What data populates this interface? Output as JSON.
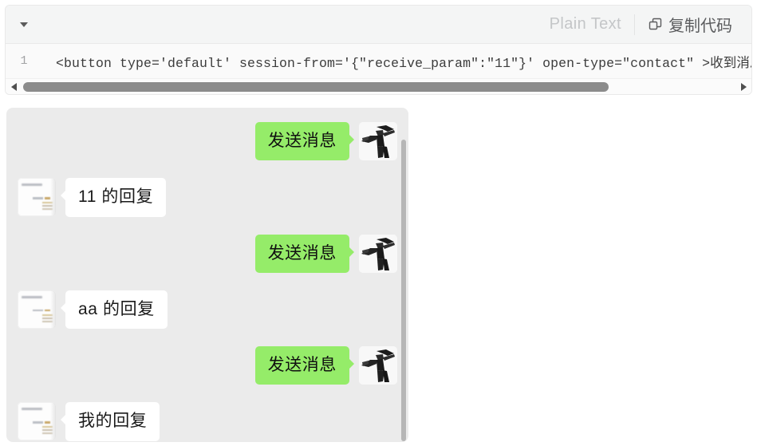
{
  "code_block": {
    "collapse_icon": "chevron-down-icon",
    "language_label": "Plain Text",
    "copy_label": "复制代码",
    "copy_icon": "copy-icon",
    "line_number": "1",
    "code_text": "<button type='default' session-from='{\"receive_param\":\"11\"}' open-type=\"contact\" >收到消息对",
    "hscroll": {
      "left_arrow": "triangle-left-icon",
      "right_arrow": "triangle-right-icon",
      "thumb_width_pct": "82"
    }
  },
  "chat": {
    "background_color": "#ebebeb",
    "outgoing_bubble_color": "#95ec69",
    "incoming_bubble_color": "#ffffff",
    "messages": [
      {
        "direction": "out",
        "text": "发送消息",
        "avatar": "photo-avatar-dancer"
      },
      {
        "direction": "in",
        "text": "11 的回复",
        "avatar": "document-thumbnail-avatar"
      },
      {
        "direction": "out",
        "text": "发送消息",
        "avatar": "photo-avatar-dancer"
      },
      {
        "direction": "in",
        "text": "aa 的回复",
        "avatar": "document-thumbnail-avatar"
      },
      {
        "direction": "out",
        "text": "发送消息",
        "avatar": "photo-avatar-dancer"
      },
      {
        "direction": "in",
        "text": "我的回复",
        "avatar": "document-thumbnail-avatar"
      }
    ]
  }
}
